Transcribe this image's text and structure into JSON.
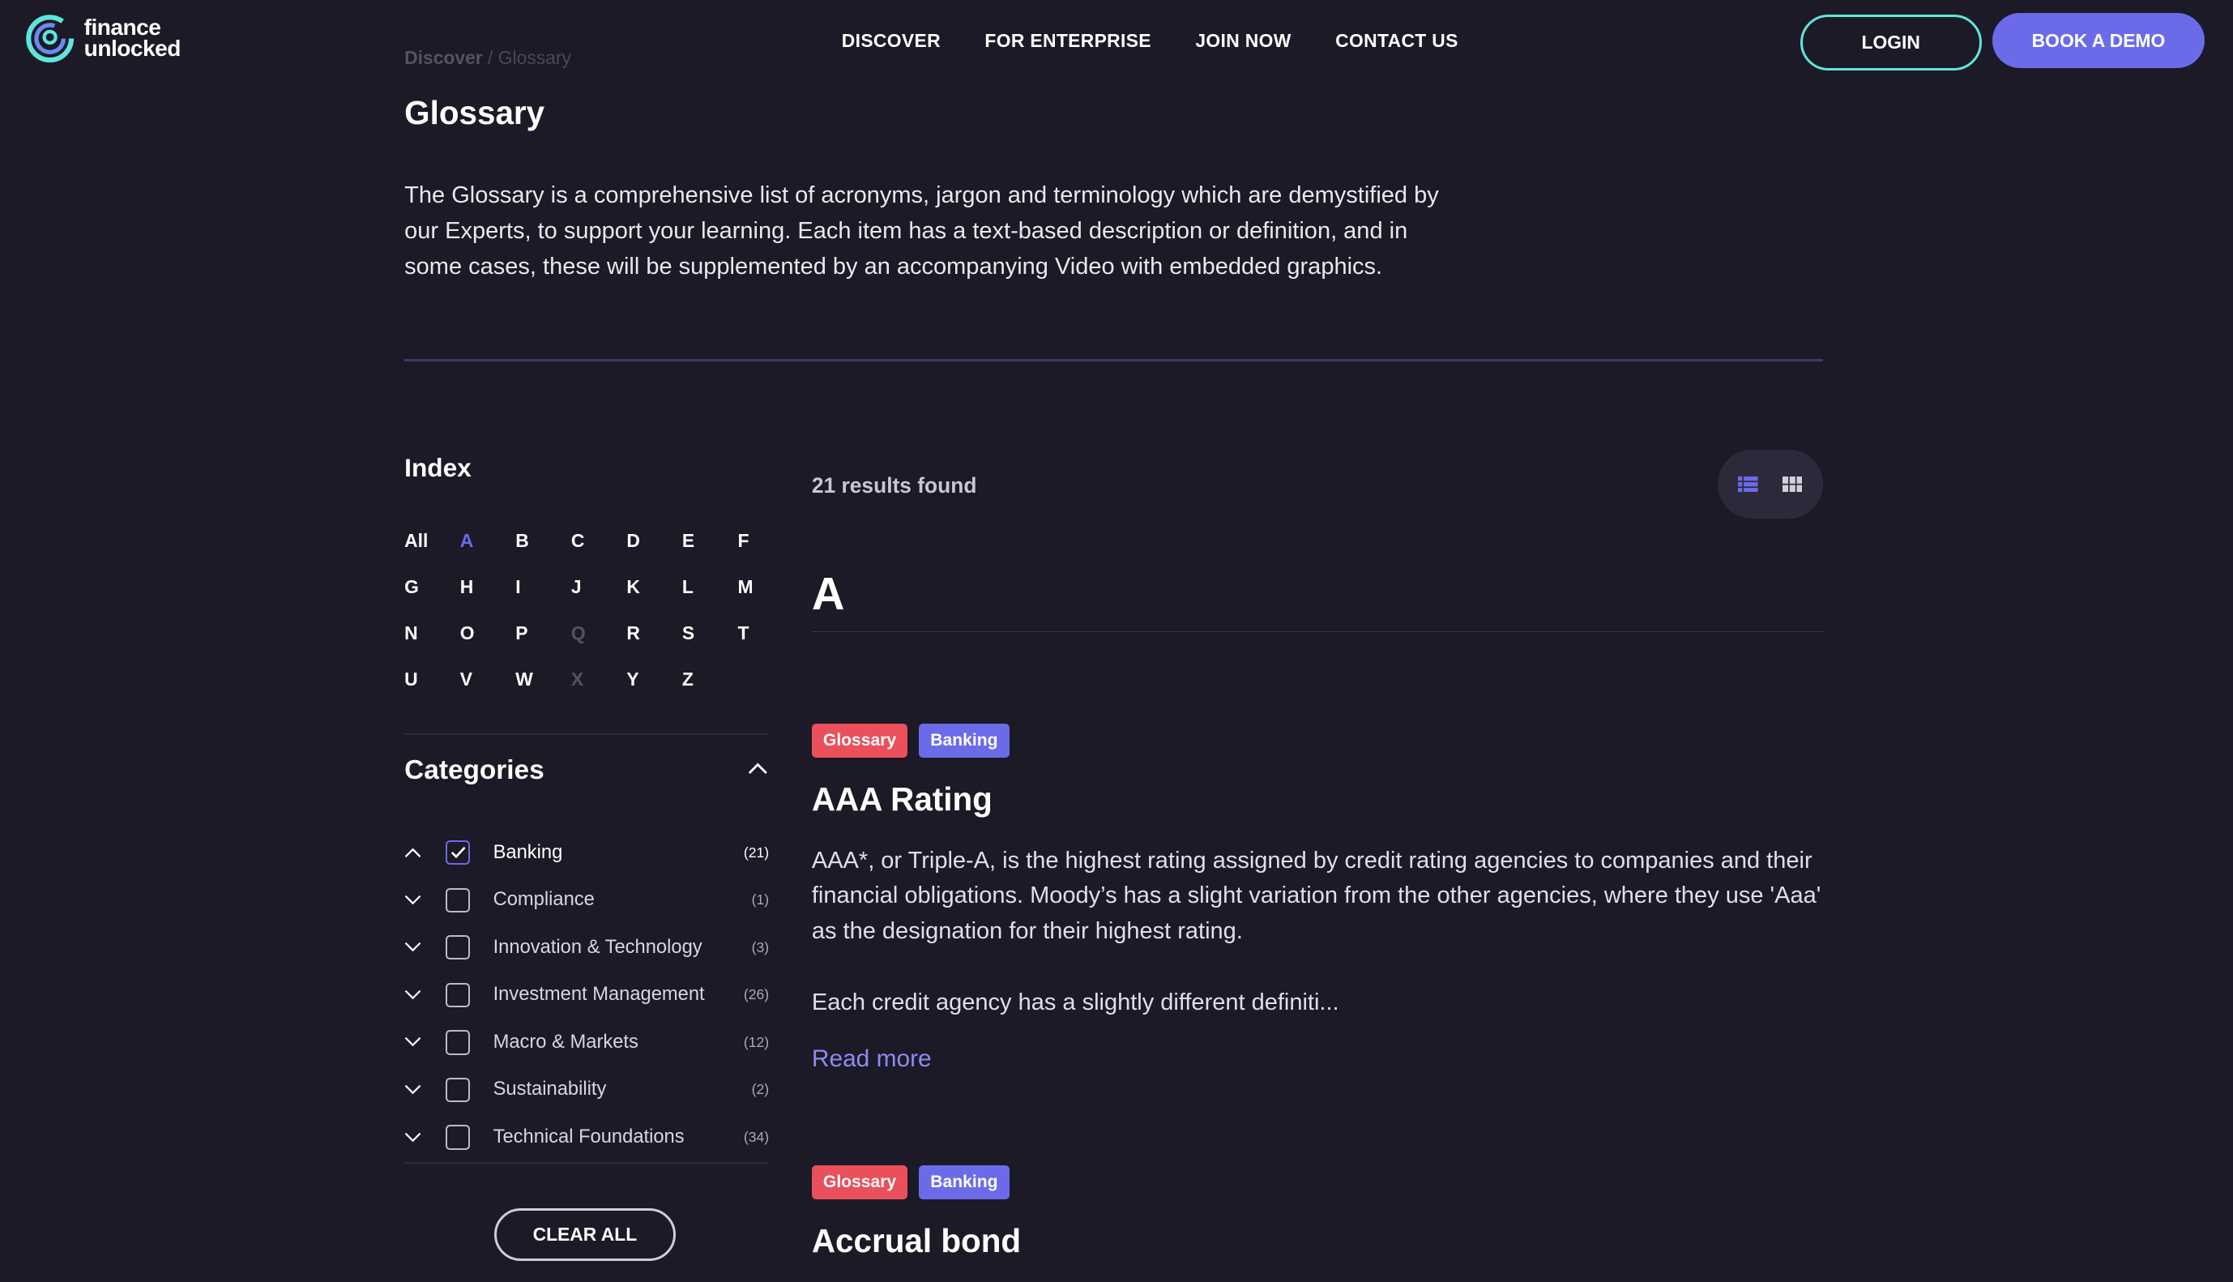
{
  "header": {
    "logo_text": [
      "finance",
      "unlocked"
    ],
    "nav": [
      "DISCOVER",
      "FOR ENTERPRISE",
      "JOIN NOW",
      "CONTACT US"
    ],
    "login": "LOGIN",
    "book_demo": "BOOK A DEMO"
  },
  "breadcrumb": {
    "items": [
      "Discover",
      "Glossary"
    ],
    "separator": "/"
  },
  "page": {
    "title": "Glossary",
    "intro": "The Glossary is a comprehensive list of acronyms, jargon and terminology which are demystified by our Experts, to support your learning. Each item has a text-based description or definition, and in some cases, these will be supplemented by an accompanying Video with embedded graphics."
  },
  "index": {
    "title": "Index",
    "letters": [
      "All",
      "A",
      "B",
      "C",
      "D",
      "E",
      "F",
      "G",
      "H",
      "I",
      "J",
      "K",
      "L",
      "M",
      "N",
      "O",
      "P",
      "Q",
      "R",
      "S",
      "T",
      "U",
      "V",
      "W",
      "X",
      "Y",
      "Z"
    ],
    "active": "A",
    "disabled": [
      "Q",
      "X"
    ]
  },
  "categories": {
    "title": "Categories",
    "items": [
      {
        "label": "Banking",
        "count": "(21)",
        "checked": true
      },
      {
        "label": "Compliance",
        "count": "(1)",
        "checked": false
      },
      {
        "label": "Innovation & Technology",
        "count": "(3)",
        "checked": false
      },
      {
        "label": "Investment Management",
        "count": "(26)",
        "checked": false
      },
      {
        "label": "Macro & Markets",
        "count": "(12)",
        "checked": false
      },
      {
        "label": "Sustainability",
        "count": "(2)",
        "checked": false
      },
      {
        "label": "Technical Foundations",
        "count": "(34)",
        "checked": false
      }
    ],
    "clear_all": "CLEAR ALL"
  },
  "results": {
    "count_text": "21 results found",
    "view_mode": "list",
    "section_letter": "A",
    "entries": [
      {
        "tags": [
          "Glossary",
          "Banking"
        ],
        "title": "AAA Rating",
        "description": "AAA*, or Triple-A, is the highest rating assigned by credit rating agencies to companies and their financial obligations. Moody’s has a slight variation from the other agencies, where they use 'Aaa' as the designation for their highest rating.",
        "excerpt": "Each credit agency has a slightly different definiti...",
        "read_more": "Read more"
      },
      {
        "tags": [
          "Glossary",
          "Banking"
        ],
        "title": "Accrual bond"
      }
    ]
  },
  "colors": {
    "background": "#1b1a26",
    "accent": "#6b6bea",
    "teal": "#5ee6dc",
    "tag_glossary": "#ea4f5c"
  }
}
